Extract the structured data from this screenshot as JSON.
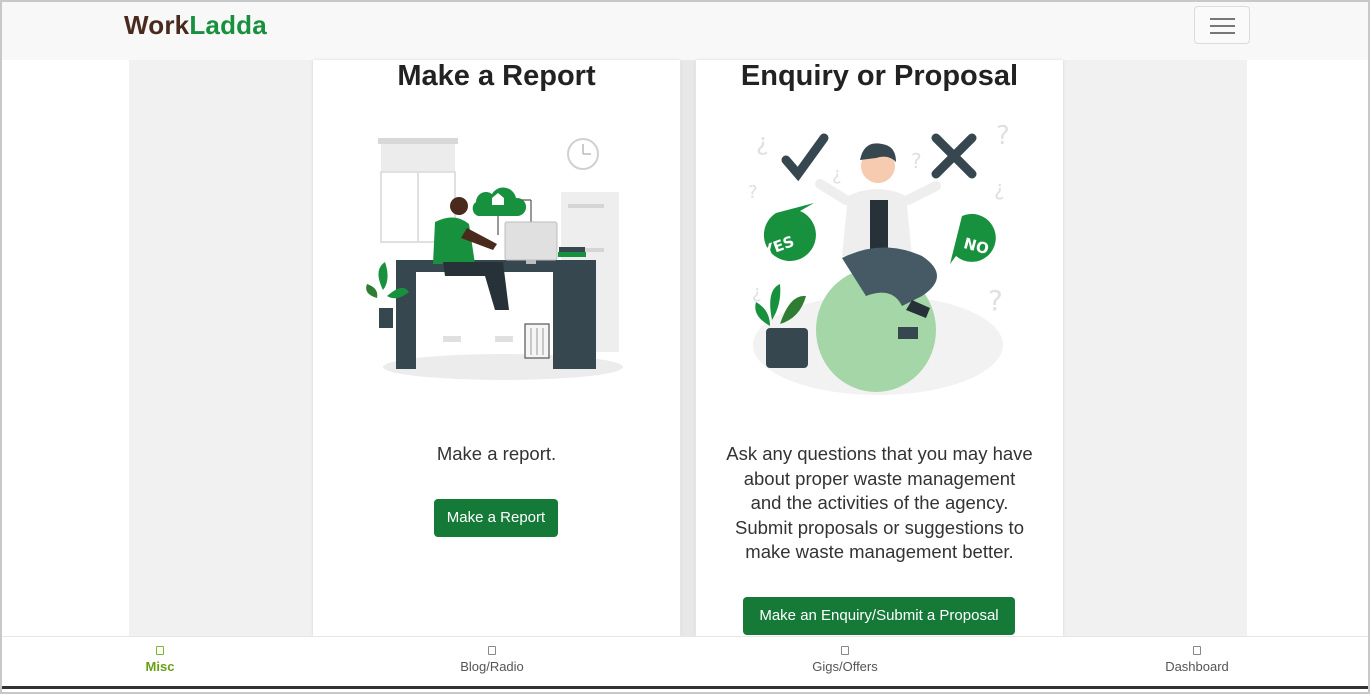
{
  "brand": {
    "part1": "Work",
    "part2": "Ladda"
  },
  "menu": {
    "icon": "hamburger-menu-icon"
  },
  "cards": {
    "report": {
      "title": "Make a Report",
      "description": "Make a report.",
      "button_label": "Make a Report",
      "illustration": "person-at-desk-illustration"
    },
    "enquiry": {
      "title": "Enquiry or Proposal",
      "description_lines": [
        "Ask any questions that you may have",
        "about proper waste management",
        "and the activities of the agency.",
        "Submit proposals or suggestions to",
        "make waste management better."
      ],
      "button_label": "Make an Enquiry/Submit a Proposal",
      "illustration": "yes-no-decision-illustration",
      "bubble_yes": "YES",
      "bubble_no": "NO"
    }
  },
  "bottom_nav": {
    "items": [
      {
        "label": "Misc",
        "icon": "misc-icon",
        "active": true
      },
      {
        "label": "Blog/Radio",
        "icon": "blog-radio-icon",
        "active": false
      },
      {
        "label": "Gigs/Offers",
        "icon": "gigs-offers-icon",
        "active": false
      },
      {
        "label": "Dashboard",
        "icon": "dashboard-icon",
        "active": false
      }
    ]
  },
  "colors": {
    "brand_dark": "#4a2a1c",
    "brand_green": "#17913d",
    "button_green": "#157a38",
    "active_nav": "#6a9f16"
  }
}
